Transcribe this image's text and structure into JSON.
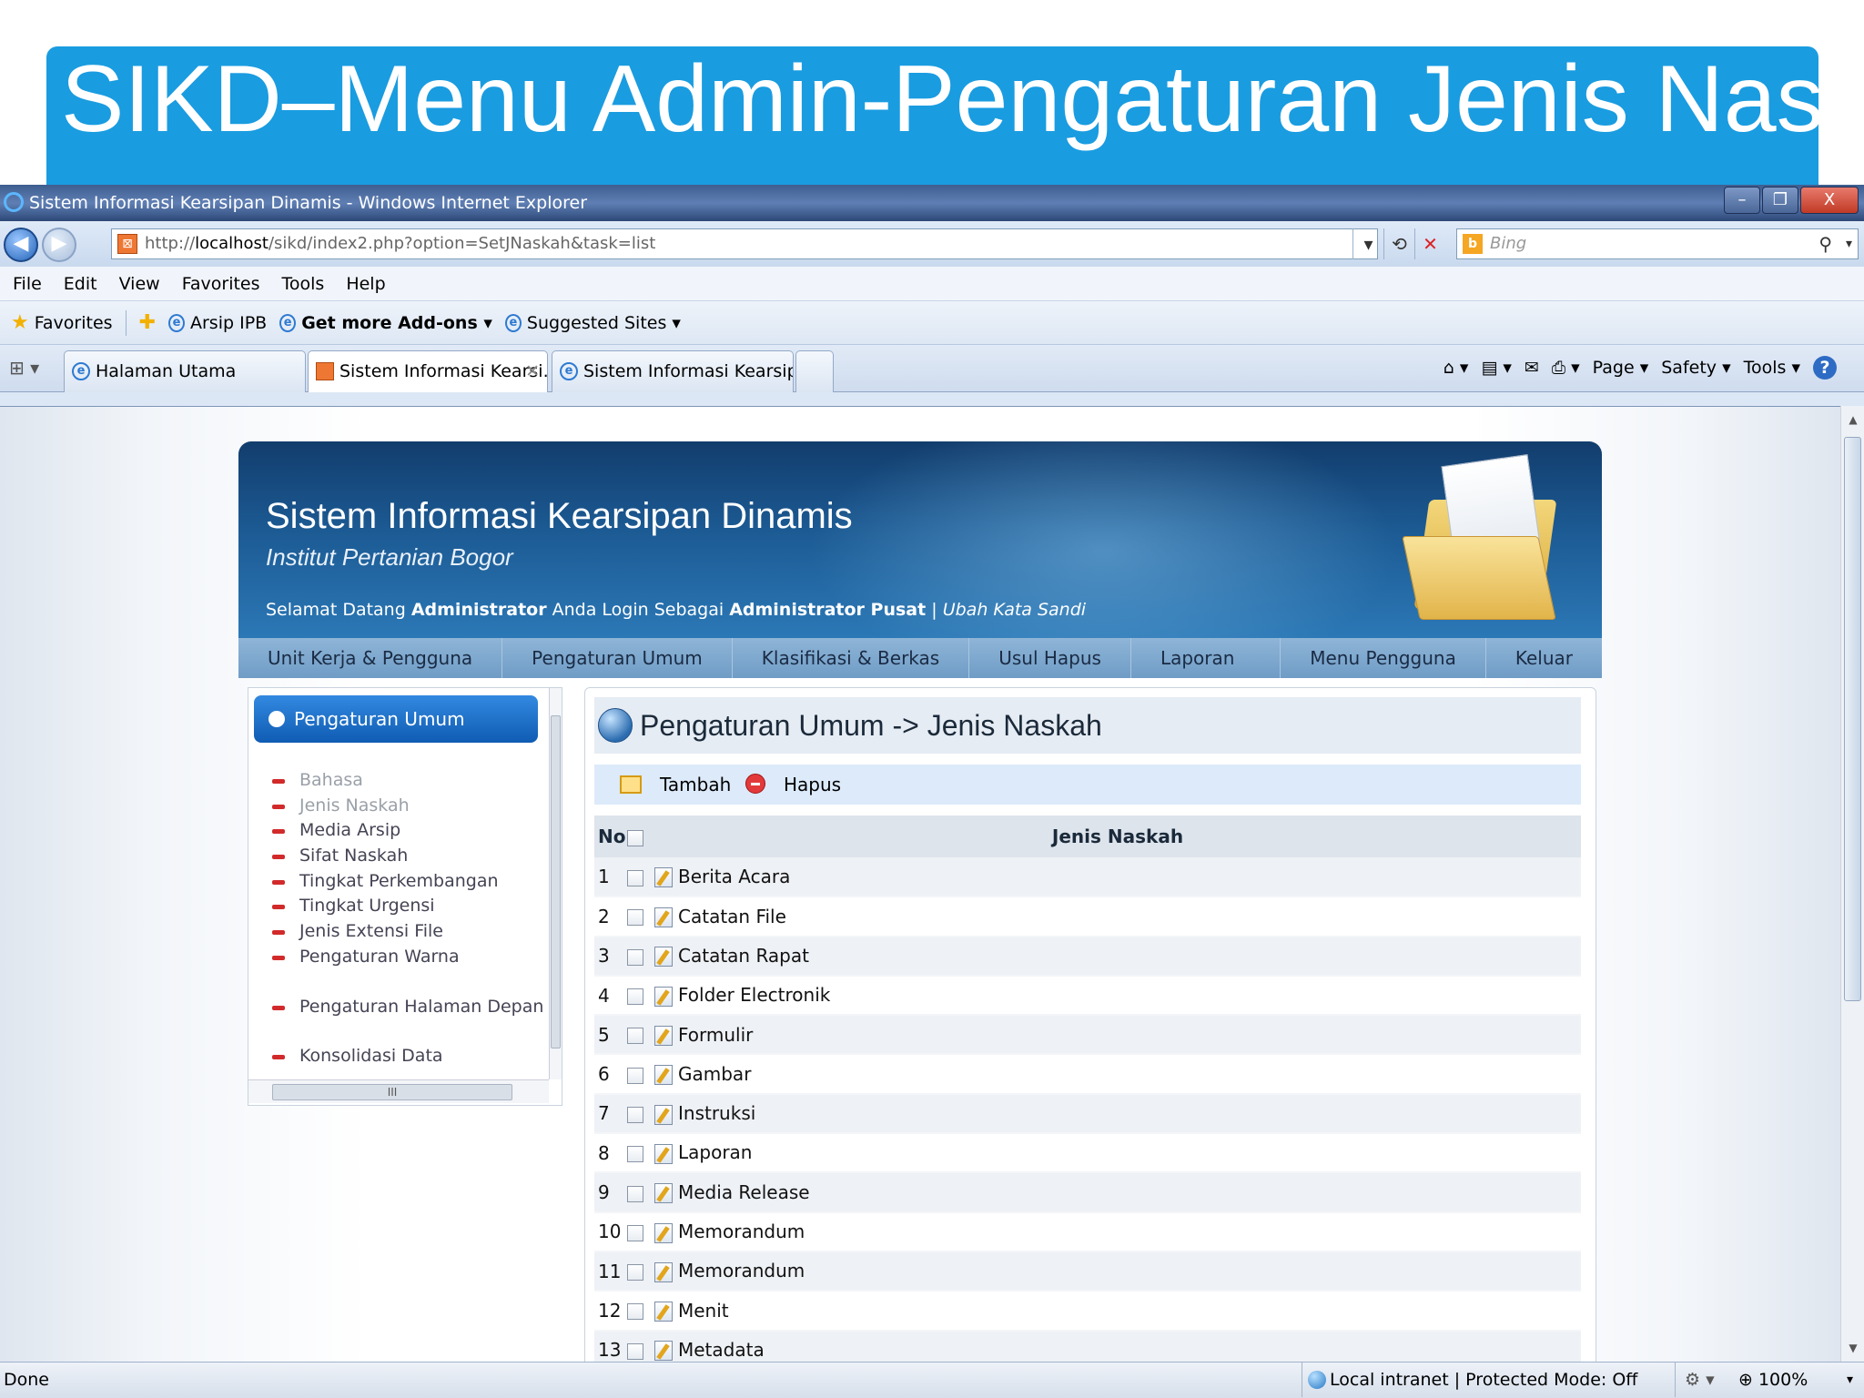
{
  "slide": {
    "title": "SIKD–Menu Admin-Pengaturan Jenis Naskah"
  },
  "window": {
    "title": "Sistem Informasi Kearsipan Dinamis - Windows Internet Explorer",
    "minimize": "–",
    "restore": "❐",
    "close": "X"
  },
  "address": {
    "url_prefix": "http://",
    "url_host": "localhost",
    "url_path": "/sikd/index2.php?option=SetJNaskah&task=list",
    "search_placeholder": "Bing"
  },
  "menubar": [
    "File",
    "Edit",
    "View",
    "Favorites",
    "Tools",
    "Help"
  ],
  "favorites": {
    "label": "Favorites",
    "items": [
      "Arsip IPB",
      "Get more Add-ons ▾",
      "Suggested Sites ▾"
    ]
  },
  "tabs": [
    {
      "label": "Halaman Utama",
      "icon": "ie-icon"
    },
    {
      "label": "Sistem Informasi Kearsi...",
      "icon": "site-icon",
      "active": true
    },
    {
      "label": "Sistem Informasi Kearsipa...",
      "icon": "ie-icon"
    }
  ],
  "command_bar": {
    "page": "Page ▾",
    "safety": "Safety ▾",
    "tools": "Tools ▾",
    "help": "?"
  },
  "app": {
    "title": "Sistem Informasi Kearsipan Dinamis",
    "subtitle": "Institut Pertanian Bogor",
    "welcome_prefix": "Selamat Datang",
    "user": "Administrator",
    "welcome_mid": "Anda Login Sebagai",
    "role": "Administrator Pusat",
    "separator": "|",
    "change_password": "Ubah Kata Sandi",
    "nav": [
      "Unit Kerja & Pengguna",
      "Pengaturan Umum",
      "Klasifikasi & Berkas",
      "Usul Hapus",
      "Laporan"
    ],
    "nav_right": [
      "Menu Pengguna",
      "Keluar"
    ]
  },
  "sidebar": {
    "heading": "Pengaturan Umum",
    "items": [
      "Bahasa",
      "Jenis Naskah",
      "Media Arsip",
      "Sifat Naskah",
      "Tingkat Perkembangan",
      "Tingkat Urgensi",
      "Jenis Extensi File",
      "Pengaturan Warna"
    ],
    "extra_items": [
      "Pengaturan Halaman Depan",
      "Konsolidasi Data"
    ]
  },
  "content": {
    "heading": "Pengaturan Umum -> Jenis Naskah",
    "add_label": "Tambah",
    "delete_label": "Hapus",
    "columns": {
      "no": "No",
      "name": "Jenis Naskah"
    },
    "rows": [
      {
        "no": "1",
        "name": "Berita Acara"
      },
      {
        "no": "2",
        "name": "Catatan File"
      },
      {
        "no": "3",
        "name": "Catatan Rapat"
      },
      {
        "no": "4",
        "name": "Folder Electronik"
      },
      {
        "no": "5",
        "name": "Formulir"
      },
      {
        "no": "6",
        "name": "Gambar"
      },
      {
        "no": "7",
        "name": "Instruksi"
      },
      {
        "no": "8",
        "name": "Laporan"
      },
      {
        "no": "9",
        "name": "Media Release"
      },
      {
        "no": "10",
        "name": "Memorandum"
      },
      {
        "no": "11",
        "name": "Memorandum"
      },
      {
        "no": "12",
        "name": "Menit"
      },
      {
        "no": "13",
        "name": "Metadata"
      }
    ]
  },
  "status": {
    "left": "Done",
    "zone": "Local intranet | Protected Mode: Off",
    "zoom": "100%"
  }
}
